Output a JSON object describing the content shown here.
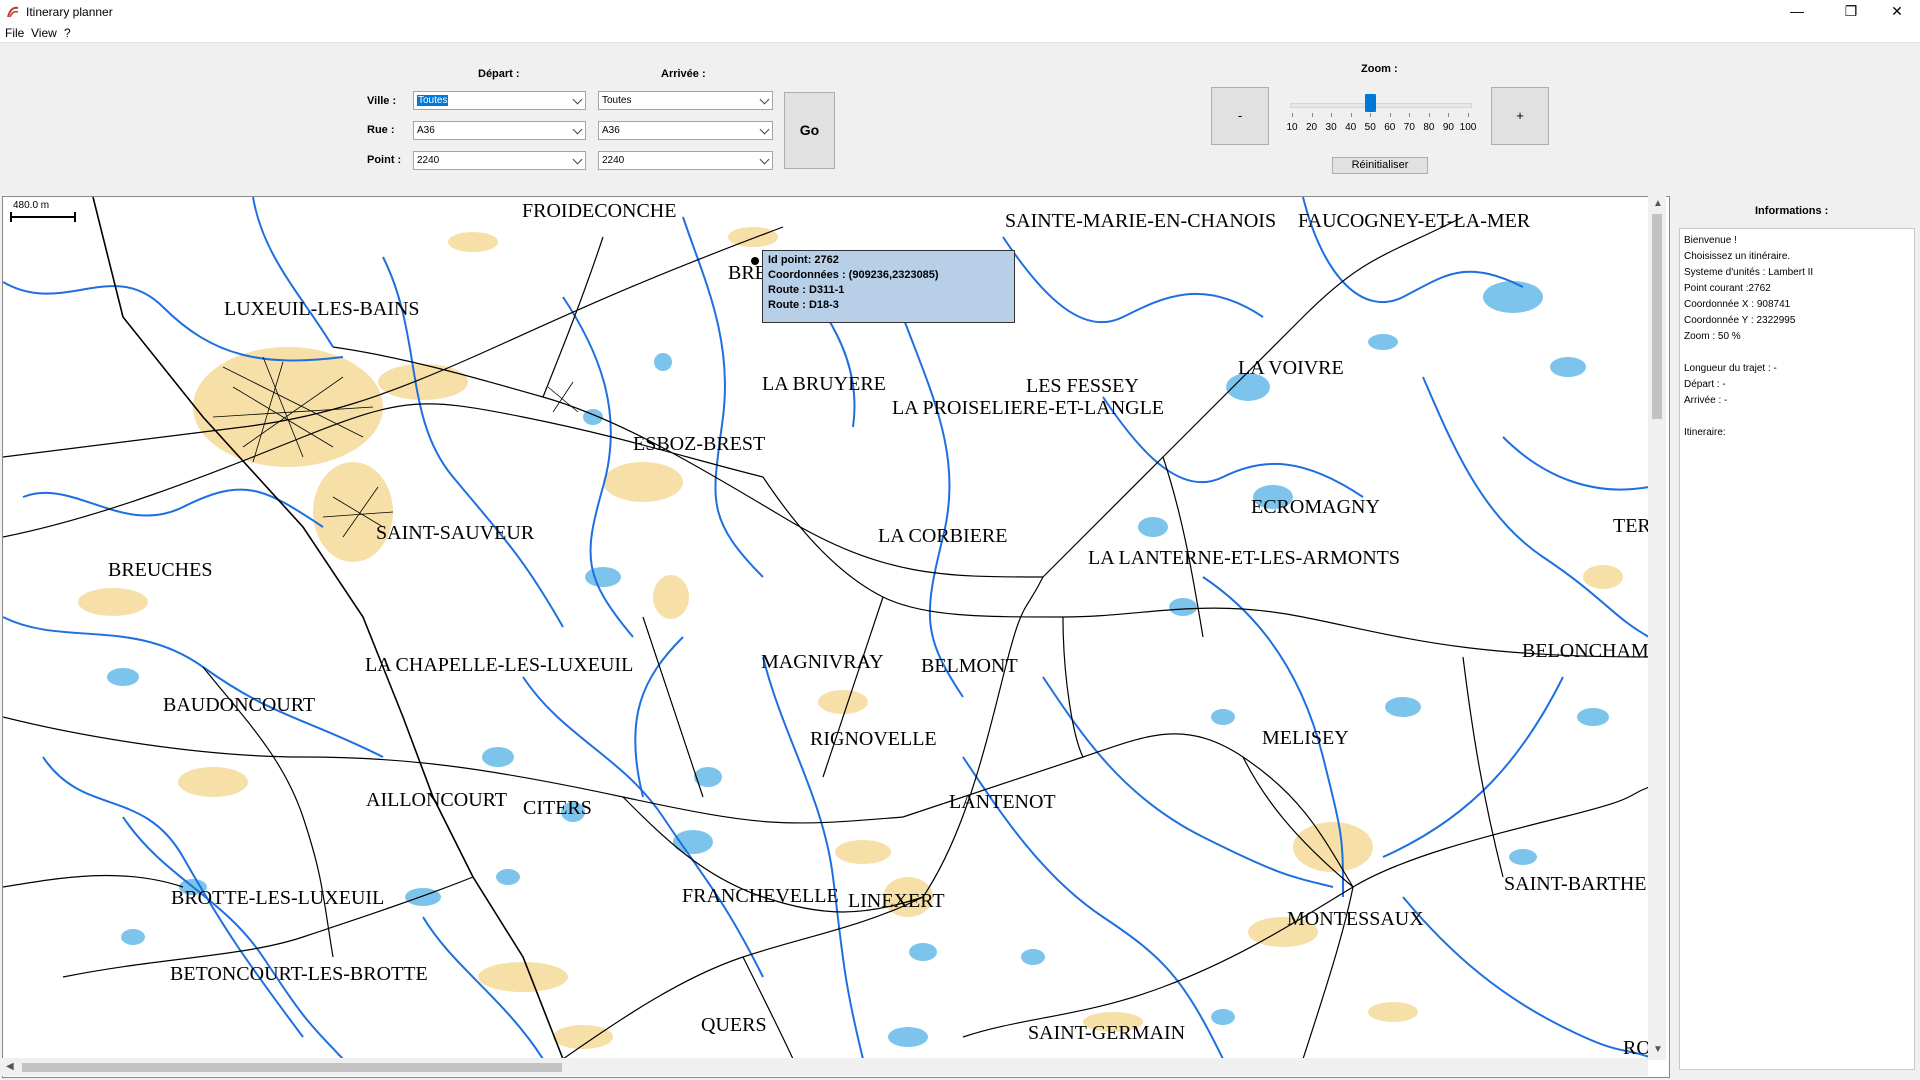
{
  "window": {
    "title": "Itinerary planner",
    "minimize": "—",
    "restore": "❐",
    "close": "✕"
  },
  "menu": {
    "file": "File",
    "view": "View",
    "help": "?"
  },
  "controls": {
    "depart_label": "Départ :",
    "arrivee_label": "Arrivée :",
    "ville_label": "Ville :",
    "rue_label": "Rue :",
    "point_label": "Point :",
    "depart": {
      "ville": "Toutes",
      "rue": "A36",
      "point": "2240"
    },
    "arrivee": {
      "ville": "Toutes",
      "rue": "A36",
      "point": "2240"
    },
    "go_label": "Go"
  },
  "zoom": {
    "label": "Zoom :",
    "minus_label": "-",
    "plus_label": "+",
    "reset_label": "Réinitialiser",
    "ticks": [
      "10",
      "20",
      "30",
      "40",
      "50",
      "60",
      "70",
      "80",
      "90",
      "100"
    ],
    "value": 50
  },
  "map": {
    "scale_text": "480.0 m",
    "labels": {
      "froideconche": "FROIDECONCHE",
      "sainte_marie": "SAINTE-MARIE-EN-CHANOIS",
      "faucogney": "FAUCOGNEY-ET-LA-MER",
      "luxeuil": "LUXEUIL-LES-BAINS",
      "bre": "BRE",
      "la_bruyere": "LA BRUYERE",
      "les_fessey": "LES FESSEY",
      "la_voivre": "LA VOIVRE",
      "la_proiseliere": "LA PROISELIERE-ET-LANGLE",
      "esboz": "ESBOZ-BREST",
      "saint_sauveur": "SAINT-SAUVEUR",
      "breuches": "BREUCHES",
      "ecromagny": "ECROMAGNY",
      "la_corbiere": "LA CORBIERE",
      "la_lanterne": "LA LANTERNE-ET-LES-ARMONTS",
      "ter": "TER",
      "la_chapelle": "LA CHAPELLE-LES-LUXEUIL",
      "magnivray": "MAGNIVRAY",
      "belmont": "BELMONT",
      "beloncham": "BELONCHAM",
      "baudoncourt": "BAUDONCOURT",
      "rignovelle": "RIGNOVELLE",
      "melisey": "MELISEY",
      "ailloncourt": "AILLONCOURT",
      "citers": "CITERS",
      "lantenot": "LANTENOT",
      "brotte": "BROTTE-LES-LUXEUIL",
      "franchevelle": "FRANCHEVELLE",
      "linexert": "LINEXERT",
      "saint_barthe": "SAINT-BARTHE",
      "montessaux": "MONTESSAUX",
      "betoncourt": "BETONCOURT-LES-BROTTE",
      "quers": "QUERS",
      "saint_germain": "SAINT-GERMAIN",
      "ro": "RO"
    },
    "tooltip": {
      "line1": "Id point: 2762",
      "line2": "Coordonnées : (909236,2323085)",
      "line3": "Route : D311-1",
      "line4": "Route : D18-3"
    },
    "colors": {
      "water": "#1e6fe0",
      "lake": "#7cc4ec",
      "urban": "#f7dfa8",
      "road": "#000000"
    }
  },
  "info": {
    "title": "Informations :",
    "lines": [
      "Bienvenue !",
      "Choisissez un itinéraire.",
      "Systeme d'unités : Lambert II",
      "Point courant :2762",
      "Coordonnée X : 908741",
      "Coordonnée Y : 2322995",
      "Zoom : 50 %",
      "",
      "Longueur du trajet : -",
      "Départ : -",
      "Arrivée : -",
      "",
      "Itineraire:"
    ]
  }
}
